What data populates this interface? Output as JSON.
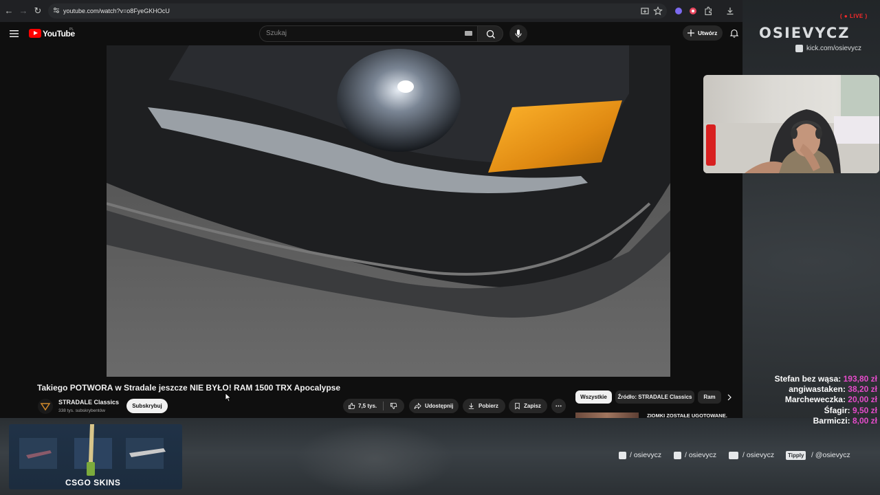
{
  "browser": {
    "url": "youtube.com/watch?v=o8FyeGKHOcU"
  },
  "youtube": {
    "brand": "YouTube",
    "country_code": "PL",
    "search_placeholder": "Szukaj",
    "create_label": "Utwórz",
    "video": {
      "title": "Takiego POTWORA w Stradale jeszcze NIE BYŁO! RAM 1500 TRX Apocalypse",
      "channel_name": "STRADALE Classics",
      "subscribers": "338 tys. subskrybentów",
      "subscribe_label": "Subskrybuj",
      "likes": "7,5 tys.",
      "share_label": "Udostępnij",
      "download_label": "Pobierz",
      "save_label": "Zapisz"
    },
    "chips": [
      "Wszystkie",
      "Źródło: STRADALE Classics",
      "Ram"
    ],
    "recommended": {
      "title": "ZIOMKI ZOSTAŁE UGOTOWANE."
    }
  },
  "stream": {
    "live_label": "LIVE",
    "streamer_name": "OSIEVYCZ",
    "kick_link": "kick.com/osievycz",
    "donations": [
      {
        "name": "Stefan bez wąsa:",
        "amount": "193,80 zł"
      },
      {
        "name": "angiwastaken:",
        "amount": "38,20 zł"
      },
      {
        "name": "Marcheweczka:",
        "amount": "20,00 zł"
      },
      {
        "name": "Śfagir:",
        "amount": "9,50 zł"
      },
      {
        "name": "Barmiczi:",
        "amount": "8,00 zł"
      }
    ],
    "socials": {
      "instagram": "/ osievycz",
      "tiktok": "/ osievycz",
      "youtube": "/ osievycz",
      "tipply_badge": "Tipply",
      "tipply": "/ @osievycz"
    },
    "sponsor": "CSGO SKINS"
  },
  "colors": {
    "donation_amount": "#e64ccb",
    "live": "#ff2a2a",
    "yt_red": "#ff0000"
  }
}
